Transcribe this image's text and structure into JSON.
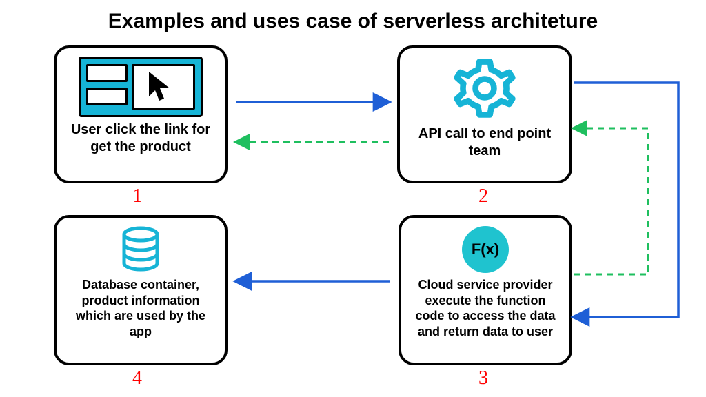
{
  "title": "Examples and uses case of serverless architeture",
  "colors": {
    "accent": "#16b4d6",
    "accent2": "#1fc3cf",
    "arrow_blue": "#1f5fd6",
    "arrow_green": "#1fbf5f",
    "number_red": "#ff0000"
  },
  "boxes": {
    "b1": {
      "caption": "User click the link for get the product",
      "number": "1",
      "icon": "ui-window-cursor"
    },
    "b2": {
      "caption": "API call to end point team",
      "number": "2",
      "icon": "gear-icon"
    },
    "b3": {
      "caption": "Cloud service provider execute the function code to access the data and return data to user",
      "number": "3",
      "icon": "fx-badge",
      "badge_label": "F(x)"
    },
    "b4": {
      "caption": "Database container, product information which are used by the app",
      "number": "4",
      "icon": "database-icon"
    }
  },
  "arrows": [
    {
      "from": "b1",
      "to": "b2",
      "style": "solid-blue"
    },
    {
      "from": "b2",
      "to": "b1",
      "style": "dashed-green"
    },
    {
      "from": "b2",
      "to": "b3",
      "style": "solid-blue-right-down"
    },
    {
      "from": "b3",
      "to": "b2",
      "style": "dashed-green-up"
    },
    {
      "from": "b3",
      "to": "b4",
      "style": "solid-blue"
    }
  ]
}
